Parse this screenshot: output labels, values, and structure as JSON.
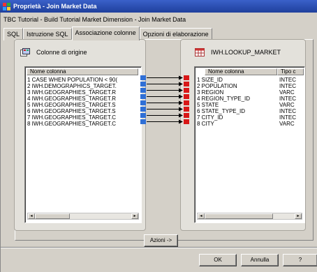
{
  "window": {
    "title": "Proprietà - Join Market Data"
  },
  "subtitle": "TBC Tutorial - Build Tutorial Market Dimension - Join Market Data",
  "tabs": [
    {
      "label": "SQL"
    },
    {
      "label": "Istruzione SQL"
    },
    {
      "label": "Associazione colonne",
      "active": true
    },
    {
      "label": "Opzioni di elaborazione"
    }
  ],
  "source": {
    "title": "Colonne di origine",
    "column_header": "Nome colonna",
    "rows": [
      "1 CASE WHEN POPULATION < 90(",
      "2 IWH.DEMOGRAPHICS_TARGET.",
      "3 IWH.GEOGRAPHIES_TARGET.R",
      "4 IWH.GEOGRAPHIES_TARGET.R",
      "5 IWH.GEOGRAPHIES_TARGET.S",
      "6 IWH.GEOGRAPHIES_TARGET.S",
      "7 IWH.GEOGRAPHIES_TARGET.C",
      "8 IWH.GEOGRAPHIES_TARGET.C"
    ]
  },
  "target": {
    "title": "IWH.LOOKUP_MARKET",
    "column_headers": [
      "Nome colonna",
      "Tipo c"
    ],
    "rows": [
      {
        "name": "1 SIZE_ID",
        "type": "INTEC"
      },
      {
        "name": "2 POPULATION",
        "type": "INTEC"
      },
      {
        "name": "3 REGION",
        "type": "VARC"
      },
      {
        "name": "4 REGION_TYPE_ID",
        "type": "INTEC"
      },
      {
        "name": "5 STATE",
        "type": "VARC"
      },
      {
        "name": "6 STATE_TYPE_ID",
        "type": "INTEC"
      },
      {
        "name": "7 CITY_ID",
        "type": "INTEC"
      },
      {
        "name": "8 CITY",
        "type": "VARC"
      }
    ]
  },
  "buttons": {
    "actions": "Azioni ->",
    "ok": "OK",
    "cancel": "Annulla",
    "help": "?"
  },
  "colors": {
    "title_bar": "#2a4fb8",
    "source_marker": "#2f6fd6",
    "target_marker": "#d81818"
  }
}
